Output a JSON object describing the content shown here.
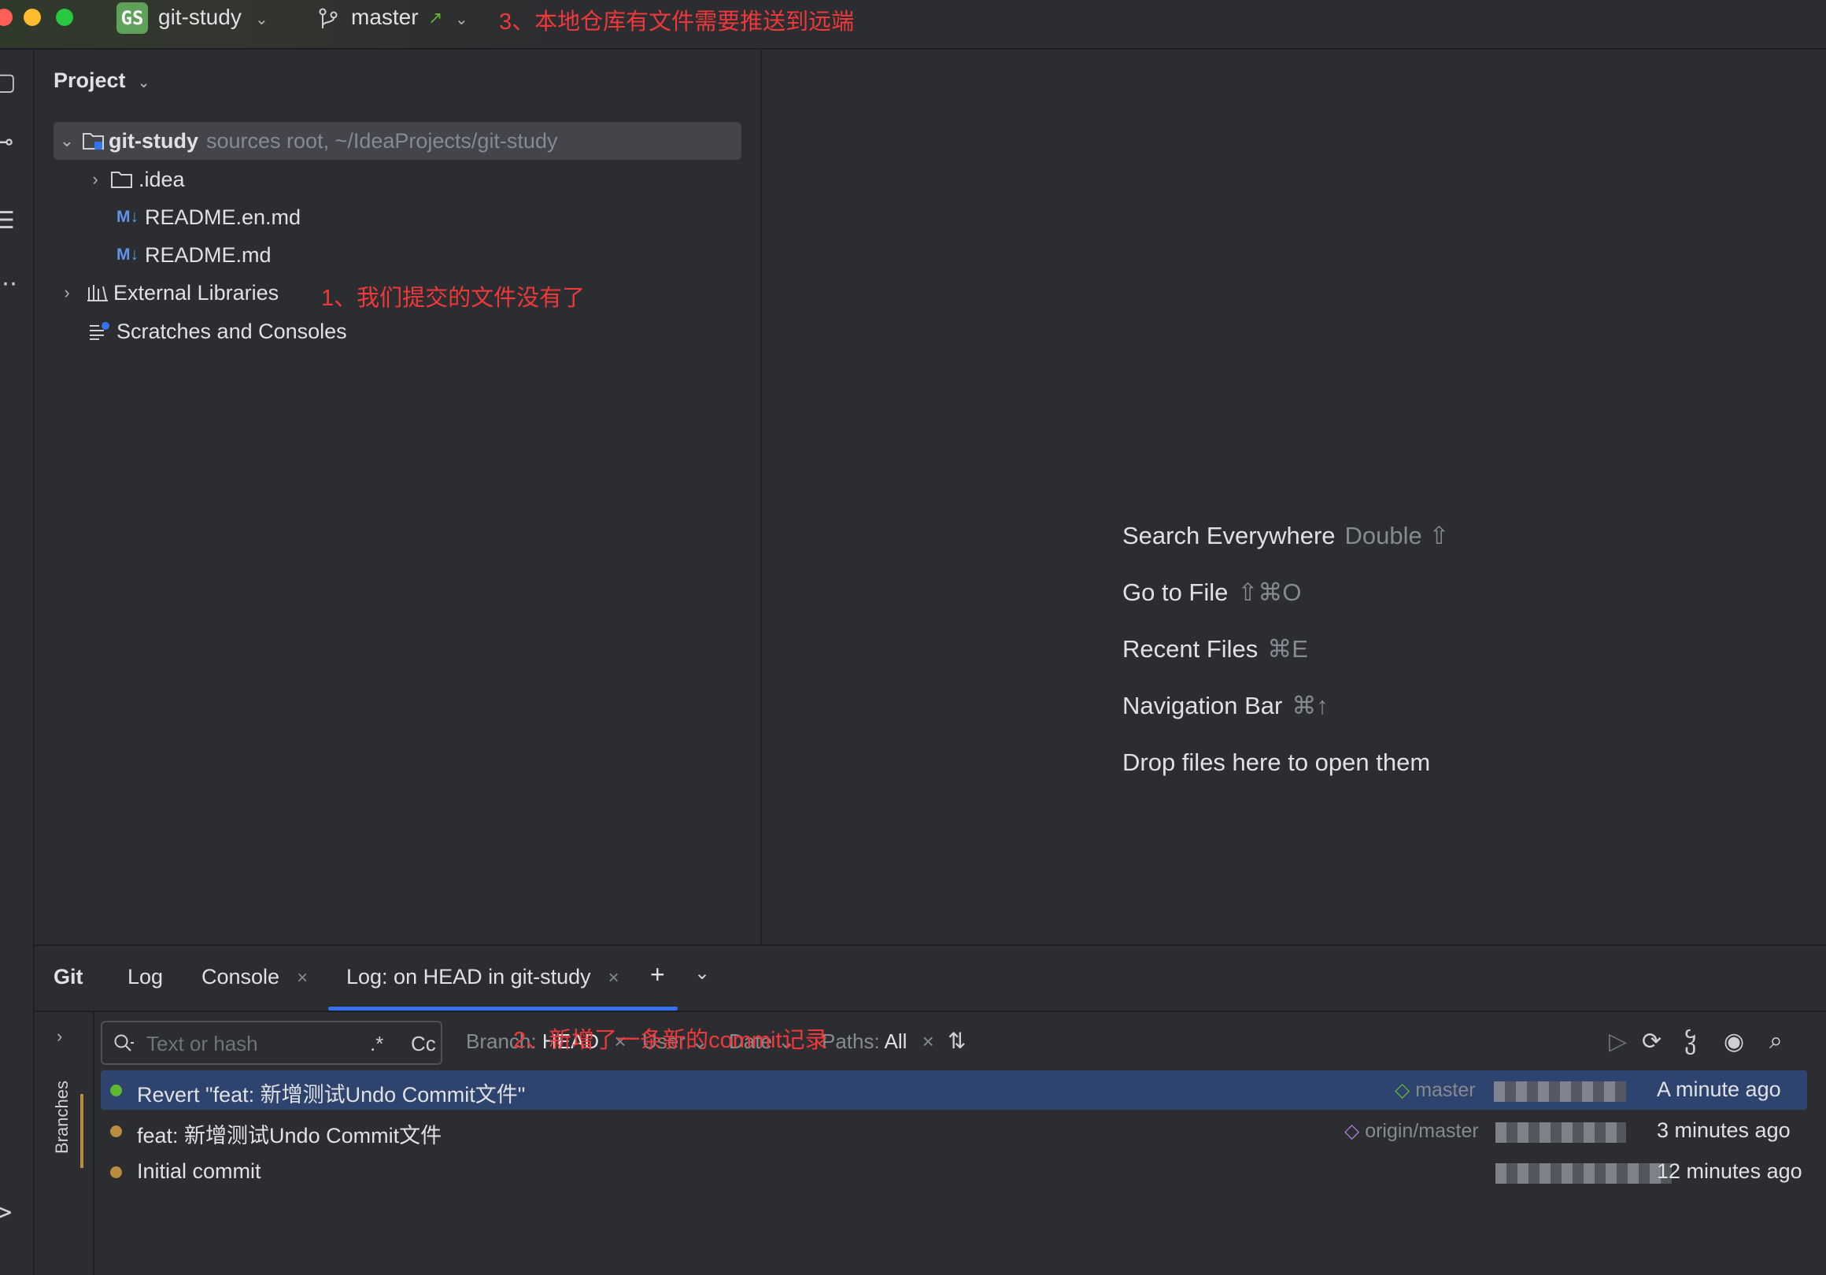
{
  "titlebar": {
    "project_badge": "GS",
    "project_name": "git-study",
    "branch": "master",
    "annotation": "3、本地仓库有文件需要推送到远端"
  },
  "project_panel": {
    "title": "Project",
    "root": {
      "name": "git-study",
      "hint": "sources root, ~/IdeaProjects/git-study"
    },
    "items": [
      {
        "label": ".idea",
        "type": "folder"
      },
      {
        "label": "README.en.md",
        "type": "markdown",
        "icon_text": "M↓"
      },
      {
        "label": "README.md",
        "type": "markdown",
        "icon_text": "M↓"
      },
      {
        "label": "External Libraries",
        "type": "library"
      },
      {
        "label": "Scratches and Consoles",
        "type": "scratches"
      }
    ],
    "annotation": "1、我们提交的文件没有了"
  },
  "editor_hints": [
    {
      "label": "Search Everywhere",
      "key": "Double ⇧"
    },
    {
      "label": "Go to File",
      "key": "⇧⌘O"
    },
    {
      "label": "Recent Files",
      "key": "⌘E"
    },
    {
      "label": "Navigation Bar",
      "key": "⌘↑"
    },
    {
      "label": "Drop files here to open them",
      "key": ""
    }
  ],
  "git_panel": {
    "tabs": [
      "Git",
      "Log",
      "Console",
      "Log: on HEAD in git-study"
    ],
    "side_label": "Branches",
    "search_placeholder": "Text or hash",
    "regex_toggle": ".*",
    "case_toggle": "Cc",
    "filters": {
      "branch_label": "Branch:",
      "branch_value": "HEAD",
      "user_label": "User",
      "date_label": "Date",
      "paths_label": "Paths:",
      "paths_value": "All"
    },
    "annotation": "2、新增了一条新的commit记录",
    "commits": [
      {
        "message": "Revert \"feat: 新增测试Undo Commit文件\"",
        "ref": "master",
        "date": "A minute ago",
        "dot_color": "#5fb832"
      },
      {
        "message": "feat: 新增测试Undo Commit文件",
        "ref": "origin/master",
        "date": "3 minutes ago",
        "dot_color": "#b88d3f"
      },
      {
        "message": "Initial commit",
        "ref": "",
        "date": "12 minutes ago",
        "dot_color": "#b88d3f"
      }
    ]
  }
}
